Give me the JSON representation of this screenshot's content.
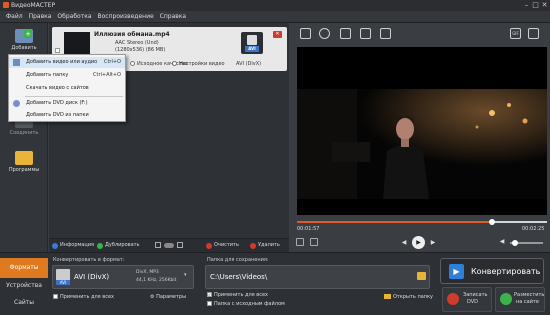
{
  "window": {
    "title": "ВидеоМАСТЕР"
  },
  "menu": [
    "Файл",
    "Правка",
    "Обработка",
    "Воспроизведение",
    "Справка"
  ],
  "sidebar": {
    "add_label": "Добавить",
    "join_label": "Соединить",
    "programs_label": "Программы"
  },
  "dropdown": {
    "items": [
      {
        "label": "Добавить видео или аудио",
        "shortcut": "Ctrl+O"
      },
      {
        "label": "Добавить папку",
        "shortcut": "Ctrl+Alt+O"
      },
      {
        "label": "Скачать видео с сайтов",
        "shortcut": ""
      },
      {
        "label": "Добавить DVD диск (F:)",
        "shortcut": ""
      },
      {
        "label": "Добавить DVD из папки",
        "shortcut": ""
      }
    ]
  },
  "file": {
    "name": "Иллюзия обмана.mp4",
    "audio": "AAC Stereo (Und)",
    "video": "(1280x536) (86 MB)",
    "quality_label": "Исходное качество",
    "settings_label": "Настройки видео",
    "format_badge": "AVI",
    "format_text": "AVI (DivX)"
  },
  "filebar": {
    "info": "Информация",
    "duplicate": "Дублировать",
    "clear": "Очистить",
    "delete": "Удалить"
  },
  "player": {
    "time_current": "00:01:57",
    "time_total": "00:02:25",
    "progress": 0.78
  },
  "bottom": {
    "tabs": [
      "Форматы",
      "Устройства",
      "Сайты"
    ],
    "convert_to_label": "Конвертировать в формат:",
    "format_name": "AVI (DivX)",
    "format_badge": "AVI",
    "codec_line1": "DivX, MP3",
    "codec_line2": "44,1 KHz, 256Kbit",
    "apply_all": "Применить для всех",
    "params": "Параметры",
    "save_folder_label": "Папка для сохранения:",
    "save_path": "C:\\Users\\Videos\\",
    "apply_all2": "Применить для всех",
    "source_folder": "Папка с исходным файлом",
    "open_folder": "Открыть папку",
    "convert": "Конвертировать",
    "burn_dvd_1": "Записать",
    "burn_dvd_2": "DVD",
    "publish_1": "Разместить",
    "publish_2": "на сайте"
  },
  "colors": {
    "accent": "#e05a2a",
    "convert_icon": "#2f7fd6"
  }
}
